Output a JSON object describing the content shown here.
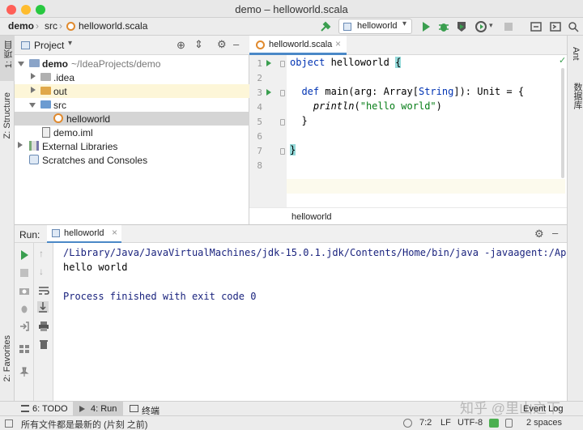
{
  "window": {
    "title": "demo – helloworld.scala"
  },
  "navbar": {
    "crumbs": [
      "demo",
      "src",
      "helloworld.scala"
    ],
    "run_config": "helloworld"
  },
  "left_strip": {
    "project_tab": "1: 项目",
    "structure_tab": "Z: Structure",
    "favorites_tab": "2: Favorites"
  },
  "right_strip": {
    "ant_tab": "Ant",
    "database_tab": "数据库"
  },
  "project": {
    "title": "Project",
    "tree": [
      {
        "label": "demo",
        "suffix": "~/IdeaProjects/demo"
      },
      {
        "label": ".idea"
      },
      {
        "label": "out"
      },
      {
        "label": "src"
      },
      {
        "label": "helloworld"
      },
      {
        "label": "demo.iml"
      },
      {
        "label": "External Libraries"
      },
      {
        "label": "Scratches and Consoles"
      }
    ]
  },
  "editor": {
    "tab": "helloworld.scala",
    "line_numbers": [
      "1",
      "2",
      "3",
      "4",
      "5",
      "6",
      "7",
      "8"
    ],
    "code": {
      "l1_kw": "object",
      "l1_name": " helloworld ",
      "l1_brace": "{",
      "l3_kw": "def",
      "l3_rest1": " main(arg: ",
      "l3_type1": "Array",
      "l3_rest2": "[",
      "l3_type2": "String",
      "l3_rest3": "]): Unit = {",
      "l4_fn": "println",
      "l4_open": "(",
      "l4_str": "\"hello world\"",
      "l4_close": ")",
      "l5": "}",
      "l7": "}"
    },
    "breadcrumb": "helloworld"
  },
  "run": {
    "label": "Run:",
    "tab": "helloworld",
    "console": [
      "/Library/Java/JavaVirtualMachines/jdk-15.0.1.jdk/Contents/Home/bin/java -javaagent:/Applica",
      "hello world",
      "",
      "Process finished with exit code 0"
    ]
  },
  "bottom_tabs": {
    "todo": "6: TODO",
    "run": "4: Run",
    "terminal": "终端",
    "event_log": "Event Log"
  },
  "status": {
    "message": "所有文件都是最新的 (片刻 之前)",
    "position": "7:2",
    "line_sep": "LF",
    "encoding": "UTF-8",
    "indent": "2 spaces"
  },
  "watermark": "知乎 @里山之下",
  "colors": {
    "accent": "#4a88c7",
    "run_green": "#3a9e4f",
    "keyword": "#0033b3",
    "string": "#067d17",
    "selection": "#d5d5d5"
  }
}
